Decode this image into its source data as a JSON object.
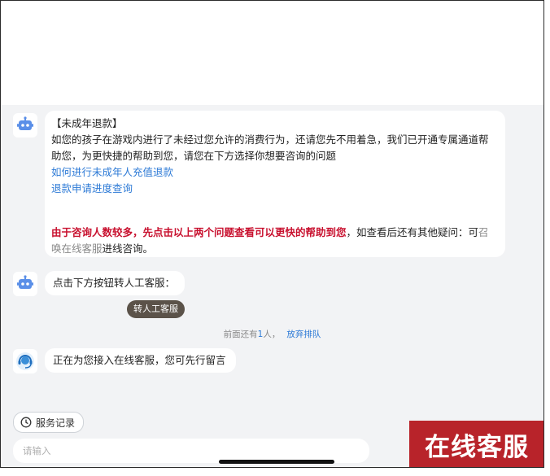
{
  "colors": {
    "link": "#2d7ad6",
    "warning": "#c8102e",
    "banner": "#b8232a",
    "button": "#5b5249"
  },
  "messages": {
    "refund": {
      "title": "【未成年退款】",
      "body": "如您的孩子在游戏内进行了未经过您允许的消费行为，还请您先不用着急，我们已开通专属通道帮助您，为更快捷的帮助到您，请您在下方选择你想要咨询的问题",
      "link1": "如何进行未成年人充值退款",
      "link2": "退款申请进度查询",
      "warning": "由于咨询人数较多，先点击以上两个问题查看可以更快的帮助到您",
      "after": "，如查看后还有其他疑问：可",
      "summon": "召唤在线客服",
      "end": "进线咨询。"
    },
    "transfer_prompt": "点击下方按钮转人工客服：",
    "transfer_button": "转人工客服",
    "queue": {
      "prefix": "前面还有",
      "count": "1",
      "suffix": "人，",
      "abandon": "放弃排队"
    },
    "connecting": "正在为您接入在线客服，您可先行留言"
  },
  "footer": {
    "history_button": "服务记录",
    "input_placeholder": "请输入"
  },
  "banner": "在线客服",
  "icons": [
    "robot-icon",
    "agent-headset-icon",
    "clock-icon"
  ]
}
